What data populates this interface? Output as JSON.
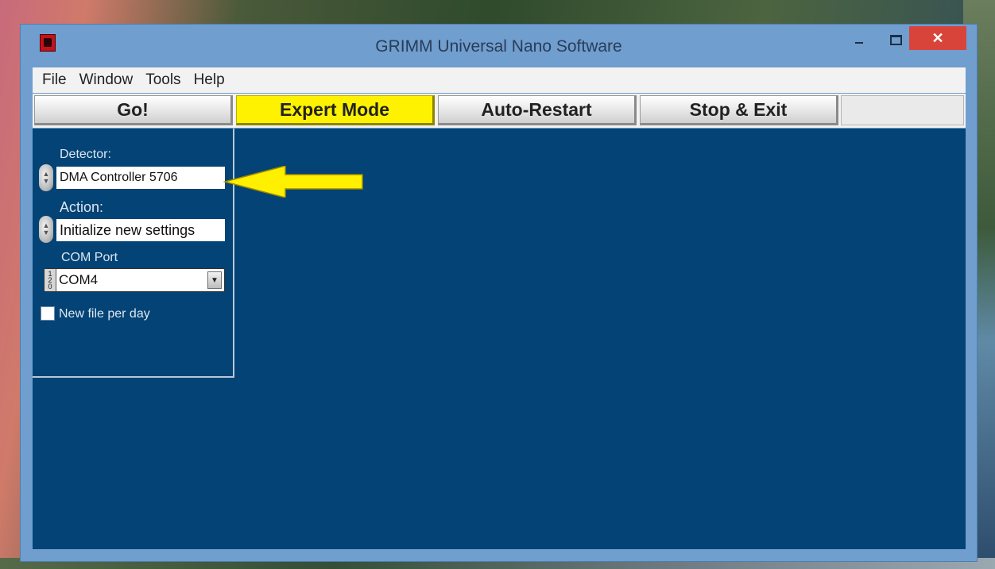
{
  "window": {
    "title": "GRIMM Universal Nano Software",
    "close_glyph": "✕"
  },
  "menu": {
    "items": [
      "File",
      "Window",
      "Tools",
      "Help"
    ]
  },
  "toolbar": {
    "buttons": [
      "Go!",
      "Expert Mode",
      "Auto-Restart",
      "Stop & Exit"
    ],
    "active_color": "#fff200"
  },
  "panel": {
    "detector_label": "Detector:",
    "detector_value": "DMA Controller 5706",
    "action_label": "Action:",
    "action_value": "Initialize new settings",
    "com_label": "COM Port",
    "com_value": "COM4",
    "new_file_label": "New file per day",
    "new_file_checked": false
  },
  "annotation": {
    "arrow_color": "#fff000",
    "arrow_icon": "left-arrow-icon"
  }
}
